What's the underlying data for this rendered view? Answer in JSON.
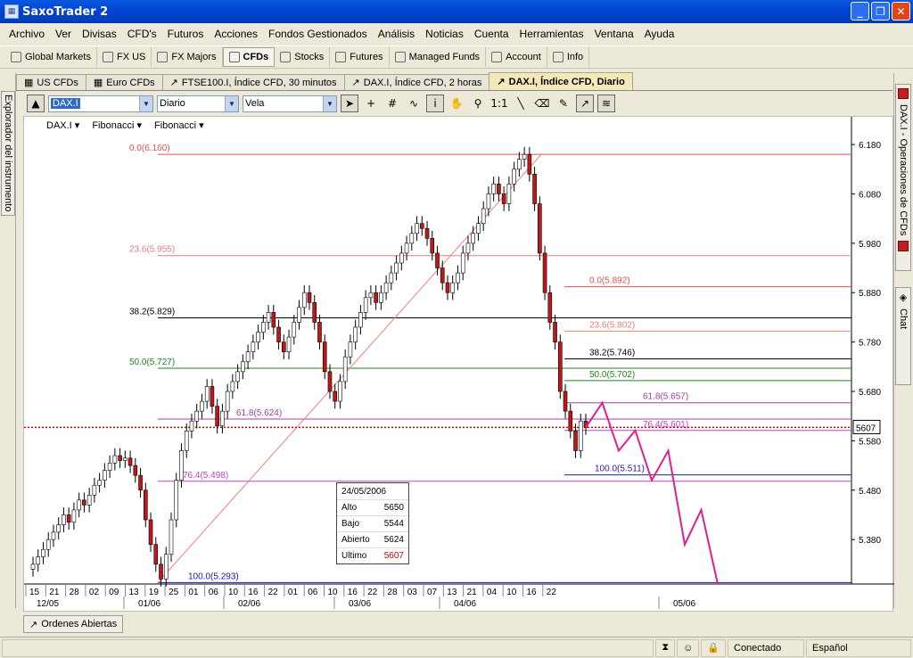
{
  "window": {
    "title": "SaxoTrader 2"
  },
  "menu": [
    "Archivo",
    "Ver",
    "Divisas",
    "CFD's",
    "Futuros",
    "Acciones",
    "Fondos Gestionados",
    "Análisis",
    "Noticias",
    "Cuenta",
    "Herramientas",
    "Ventana",
    "Ayuda"
  ],
  "toolbar": [
    "Global Markets",
    "FX US",
    "FX Majors",
    "CFDs",
    "Stocks",
    "Futures",
    "Managed Funds",
    "Account",
    "Info"
  ],
  "tabs": [
    "US CFDs",
    "Euro CFDs",
    "FTSE100.I, Índice CFD, 30 minutos",
    "DAX.I, Índice CFD, 2 horas",
    "DAX.I, Índice CFD, Diario"
  ],
  "left_panel": "Explorador del instrumento",
  "right_panel": {
    "tab1": "DAX.I - Operaciones de CFDs",
    "tab2": "Chat"
  },
  "chart_toolbar": {
    "instrument": "DAX.I",
    "period": "Diario",
    "type": "Vela"
  },
  "indicators": [
    "DAX.I",
    "Fibonacci",
    "Fibonacci"
  ],
  "ohlc": {
    "date": "24/05/2006",
    "alto_label": "Alto",
    "alto": "5650",
    "bajo_label": "Bajo",
    "bajo": "5544",
    "abierto_label": "Abierto",
    "abierto": "5624",
    "ultimo_label": "Ultimo",
    "ultimo": "5607"
  },
  "bottom_tab": "Ordenes Abiertas",
  "status": {
    "connection": "Conectado",
    "language": "Español"
  },
  "colors": {
    "up": "#ffffff",
    "down": "#c01818",
    "fib1": "#e05050",
    "fib2": "#a040a0",
    "proj": "#e0208a",
    "price_line": "#e00000"
  },
  "chart_data": {
    "type": "candlestick",
    "yticks": [
      "6.180",
      "6.080",
      "5.980",
      "5.880",
      "5.780",
      "5.680",
      "5.580",
      "5.480",
      "5.380"
    ],
    "ylim": [
      5290,
      6200
    ],
    "xticks": [
      "15",
      "21",
      "28",
      "02",
      "09",
      "13",
      "19",
      "25",
      "01",
      "06",
      "10",
      "16",
      "22",
      "01",
      "06",
      "10",
      "16",
      "22",
      "28",
      "03",
      "07",
      "13",
      "21",
      "04",
      "10",
      "16",
      "22"
    ],
    "months": [
      "12/05",
      "01/06",
      "02/06",
      "03/06",
      "04/06",
      "05/06"
    ],
    "current_price": "5607",
    "fib_up": [
      {
        "label": "0.0(6.160)",
        "value": 6160
      },
      {
        "label": "23.6(5.955)",
        "value": 5955
      },
      {
        "label": "38.2(5.829)",
        "value": 5829
      },
      {
        "label": "50.0(5.727)",
        "value": 5727
      },
      {
        "label": "61.8(5.624)",
        "value": 5624
      },
      {
        "label": "76.4(5.498)",
        "value": 5498
      },
      {
        "label": "100.0(5.293)",
        "value": 5293
      }
    ],
    "fib_down": [
      {
        "label": "0.0(5.892)",
        "value": 5892
      },
      {
        "label": "23.6(5.802)",
        "value": 5802
      },
      {
        "label": "38.2(5.746)",
        "value": 5746
      },
      {
        "label": "50.0(5.702)",
        "value": 5702
      },
      {
        "label": "61.8(5.657)",
        "value": 5657
      },
      {
        "label": "76.4(5.601)",
        "value": 5601
      },
      {
        "label": "100.0(5.511)",
        "value": 5511
      }
    ],
    "closes": [
      5330,
      5345,
      5360,
      5380,
      5395,
      5410,
      5430,
      5415,
      5440,
      5460,
      5450,
      5470,
      5490,
      5500,
      5520,
      5535,
      5550,
      5540,
      5545,
      5530,
      5510,
      5480,
      5420,
      5370,
      5330,
      5300,
      5350,
      5420,
      5500,
      5560,
      5600,
      5620,
      5640,
      5660,
      5690,
      5650,
      5610,
      5640,
      5680,
      5700,
      5720,
      5740,
      5760,
      5780,
      5800,
      5820,
      5840,
      5810,
      5780,
      5760,
      5790,
      5820,
      5850,
      5880,
      5860,
      5820,
      5780,
      5720,
      5680,
      5660,
      5700,
      5750,
      5780,
      5810,
      5840,
      5870,
      5880,
      5860,
      5880,
      5900,
      5920,
      5940,
      5960,
      5980,
      6000,
      6020,
      6010,
      5990,
      5960,
      5930,
      5900,
      5880,
      5900,
      5920,
      5960,
      5980,
      6000,
      6020,
      6050,
      6080,
      6100,
      6080,
      6060,
      6100,
      6130,
      6150,
      6160,
      6120,
      6060,
      5960,
      5880,
      5820,
      5780,
      5680,
      5640,
      5600,
      5560,
      5620,
      5607
    ],
    "projection": [
      5607,
      5657,
      5560,
      5601,
      5500,
      5560,
      5370,
      5440,
      5290
    ]
  }
}
